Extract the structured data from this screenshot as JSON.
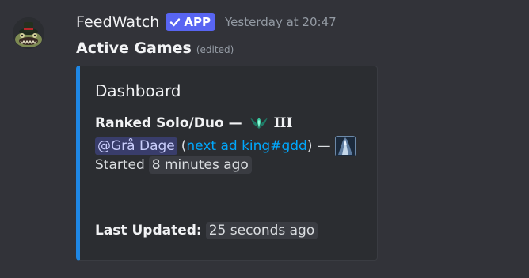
{
  "message": {
    "username": "FeedWatch",
    "badge_label": "APP",
    "timestamp": "Yesterday at 20:47",
    "content_title": "Active Games",
    "edited_label": "(edited)"
  },
  "embed": {
    "accent_color": "#1e87e5",
    "title": "Dashboard",
    "queue_label": "Ranked Solo/Duo —",
    "rank_icon": "emerald-rank-icon",
    "division": "III",
    "mention": "@Grå Dage",
    "riot_id": "next ad king#gdd",
    "paren_open": "(",
    "paren_close": ")",
    "separator": "—",
    "champion_icon": "champion-portrait-icon",
    "started_label": "Started",
    "started_value": "8 minutes ago",
    "updated_label": "Last Updated:",
    "updated_value": "25 seconds ago"
  },
  "colors": {
    "background": "#323339",
    "embed_background": "#2b2d31",
    "badge": "#5865f2",
    "link": "#00a8fc",
    "mention_bg": "rgba(88,101,242,0.3)"
  }
}
